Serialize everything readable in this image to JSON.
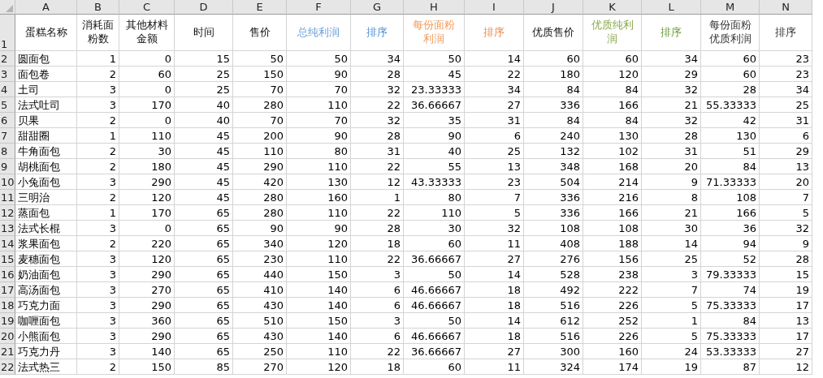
{
  "column_letters": [
    "A",
    "B",
    "C",
    "D",
    "E",
    "F",
    "G",
    "H",
    "I",
    "J",
    "K",
    "L",
    "M",
    "N"
  ],
  "header_row": {
    "row_number": "1",
    "cells": [
      {
        "text": "蛋糕名称"
      },
      {
        "text": "消耗面粉数"
      },
      {
        "text": "其他材料金额"
      },
      {
        "text": "时间"
      },
      {
        "text": "售价"
      },
      {
        "text": "总纯利润",
        "color": "#6a9fd8"
      },
      {
        "text": "排序",
        "color": "#4f8fd6"
      },
      {
        "text": "每份面粉利润",
        "color": "#f39a5a"
      },
      {
        "text": "排序",
        "color": "#f0884a"
      },
      {
        "text": "优质售价"
      },
      {
        "text": "优质纯利润",
        "color": "#8aa94e"
      },
      {
        "text": "排序",
        "color": "#6e9a3c"
      },
      {
        "text": "每份面粉优质利润",
        "color": "#333333"
      },
      {
        "text": "排序",
        "color": "#333333"
      }
    ]
  },
  "rows": [
    {
      "row_number": "2",
      "cells": [
        "圆面包",
        "1",
        "0",
        "15",
        "50",
        "50",
        "34",
        "50",
        "14",
        "60",
        "60",
        "34",
        "60",
        "23"
      ]
    },
    {
      "row_number": "3",
      "cells": [
        "面包卷",
        "2",
        "60",
        "25",
        "150",
        "90",
        "28",
        "45",
        "22",
        "180",
        "120",
        "29",
        "60",
        "23"
      ]
    },
    {
      "row_number": "4",
      "cells": [
        "土司",
        "3",
        "0",
        "25",
        "70",
        "70",
        "32",
        "23.33333",
        "34",
        "84",
        "84",
        "32",
        "28",
        "34"
      ]
    },
    {
      "row_number": "5",
      "cells": [
        "法式吐司",
        "3",
        "170",
        "40",
        "280",
        "110",
        "22",
        "36.66667",
        "27",
        "336",
        "166",
        "21",
        "55.33333",
        "25"
      ]
    },
    {
      "row_number": "6",
      "cells": [
        "贝果",
        "2",
        "0",
        "40",
        "70",
        "70",
        "32",
        "35",
        "31",
        "84",
        "84",
        "32",
        "42",
        "31"
      ]
    },
    {
      "row_number": "7",
      "cells": [
        "甜甜圈",
        "1",
        "110",
        "45",
        "200",
        "90",
        "28",
        "90",
        "6",
        "240",
        "130",
        "28",
        "130",
        "6"
      ]
    },
    {
      "row_number": "8",
      "cells": [
        "牛角面包",
        "2",
        "30",
        "45",
        "110",
        "80",
        "31",
        "40",
        "25",
        "132",
        "102",
        "31",
        "51",
        "29"
      ]
    },
    {
      "row_number": "9",
      "cells": [
        "胡桃面包",
        "2",
        "180",
        "45",
        "290",
        "110",
        "22",
        "55",
        "13",
        "348",
        "168",
        "20",
        "84",
        "13"
      ]
    },
    {
      "row_number": "10",
      "cells": [
        "小兔面包",
        "3",
        "290",
        "45",
        "420",
        "130",
        "12",
        "43.33333",
        "23",
        "504",
        "214",
        "9",
        "71.33333",
        "20"
      ]
    },
    {
      "row_number": "11",
      "cells": [
        "三明治",
        "2",
        "120",
        "45",
        "280",
        "160",
        "1",
        "80",
        "7",
        "336",
        "216",
        "8",
        "108",
        "7"
      ]
    },
    {
      "row_number": "12",
      "cells": [
        "蒸面包",
        "1",
        "170",
        "65",
        "280",
        "110",
        "22",
        "110",
        "5",
        "336",
        "166",
        "21",
        "166",
        "5"
      ]
    },
    {
      "row_number": "13",
      "cells": [
        "法式长棍",
        "3",
        "0",
        "65",
        "90",
        "90",
        "28",
        "30",
        "32",
        "108",
        "108",
        "30",
        "36",
        "32"
      ]
    },
    {
      "row_number": "14",
      "cells": [
        "浆果面包",
        "2",
        "220",
        "65",
        "340",
        "120",
        "18",
        "60",
        "11",
        "408",
        "188",
        "14",
        "94",
        "9"
      ]
    },
    {
      "row_number": "15",
      "cells": [
        "麦穗面包",
        "3",
        "120",
        "65",
        "230",
        "110",
        "22",
        "36.66667",
        "27",
        "276",
        "156",
        "25",
        "52",
        "28"
      ]
    },
    {
      "row_number": "16",
      "cells": [
        "奶油面包",
        "3",
        "290",
        "65",
        "440",
        "150",
        "3",
        "50",
        "14",
        "528",
        "238",
        "3",
        "79.33333",
        "15"
      ]
    },
    {
      "row_number": "17",
      "cells": [
        "高汤面包",
        "3",
        "270",
        "65",
        "410",
        "140",
        "6",
        "46.66667",
        "18",
        "492",
        "222",
        "7",
        "74",
        "19"
      ]
    },
    {
      "row_number": "18",
      "cells": [
        "巧克力面",
        "3",
        "290",
        "65",
        "430",
        "140",
        "6",
        "46.66667",
        "18",
        "516",
        "226",
        "5",
        "75.33333",
        "17"
      ]
    },
    {
      "row_number": "19",
      "cells": [
        "咖喱面包",
        "3",
        "360",
        "65",
        "510",
        "150",
        "3",
        "50",
        "14",
        "612",
        "252",
        "1",
        "84",
        "13"
      ]
    },
    {
      "row_number": "20",
      "cells": [
        "小熊面包",
        "3",
        "290",
        "65",
        "430",
        "140",
        "6",
        "46.66667",
        "18",
        "516",
        "226",
        "5",
        "75.33333",
        "17"
      ]
    },
    {
      "row_number": "21",
      "cells": [
        "巧克力丹",
        "3",
        "140",
        "65",
        "250",
        "110",
        "22",
        "36.66667",
        "27",
        "300",
        "160",
        "24",
        "53.33333",
        "27"
      ]
    },
    {
      "row_number": "22",
      "cells": [
        "法式热三",
        "2",
        "150",
        "85",
        "270",
        "120",
        "18",
        "60",
        "11",
        "324",
        "174",
        "19",
        "87",
        "12"
      ]
    }
  ]
}
